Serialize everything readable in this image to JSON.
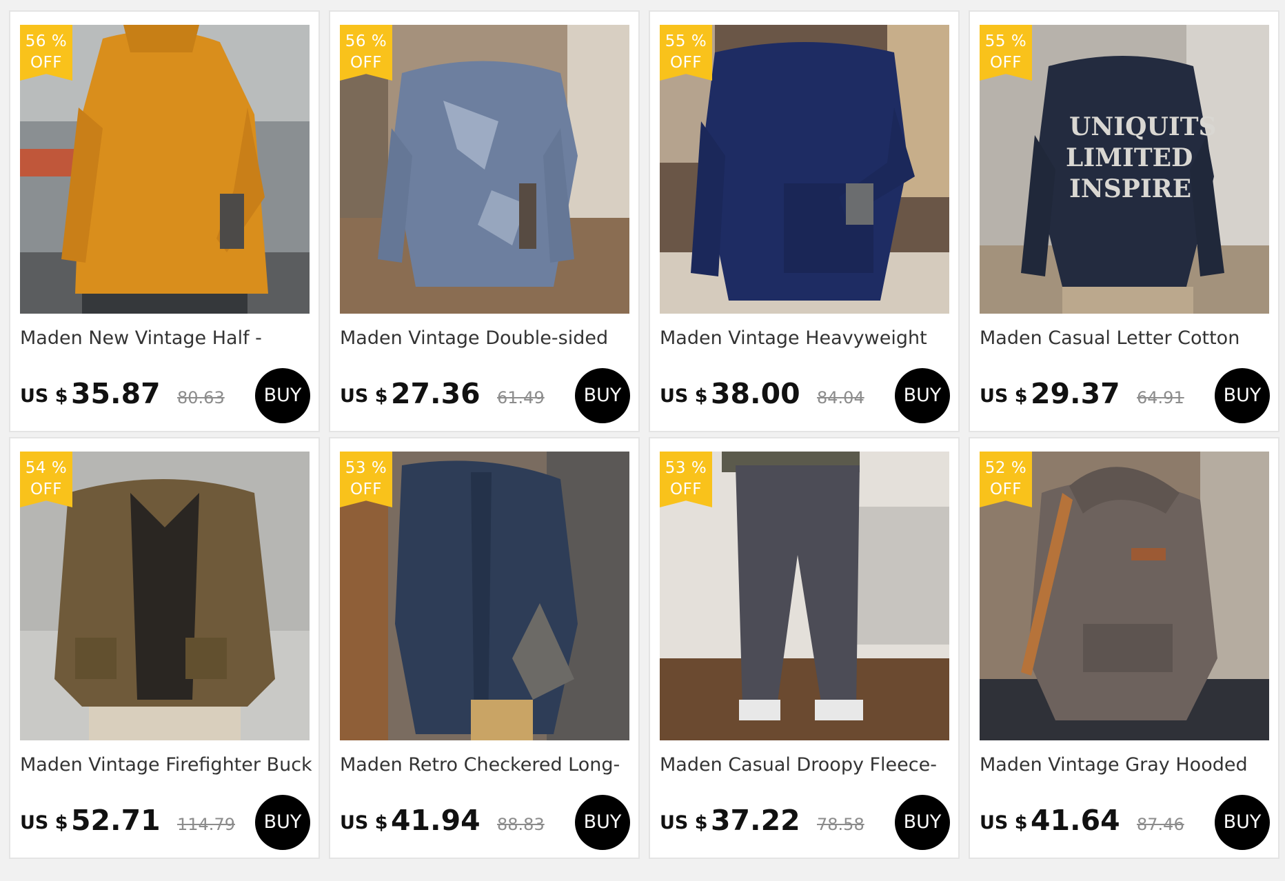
{
  "colors": {
    "badge": "#f9c21b",
    "buy_button": "#000000",
    "page_background": "#f1f1f1"
  },
  "products": [
    {
      "discount_pct": "56 %",
      "discount_off": "OFF",
      "title": "Maden New Vintage Half -",
      "currency": "US $",
      "price": "35.87",
      "old_price": "80.63",
      "buy_label": "BUY",
      "image": "man in mustard yellow knit sweater"
    },
    {
      "discount_pct": "56 %",
      "discount_off": "OFF",
      "title": "Maden Vintage Double-sided",
      "currency": "US $",
      "price": "27.36",
      "old_price": "61.49",
      "buy_label": "BUY",
      "image": "man in heather blue long sleeve tee"
    },
    {
      "discount_pct": "55 %",
      "discount_off": "OFF",
      "title": "Maden Vintage Heavyweight",
      "currency": "US $",
      "price": "38.00",
      "old_price": "84.04",
      "buy_label": "BUY",
      "image": "man in navy crewneck sweatshirt with pocket"
    },
    {
      "discount_pct": "55 %",
      "discount_off": "OFF",
      "title": "Maden Casual Letter Cotton",
      "currency": "US $",
      "price": "29.37",
      "old_price": "64.91",
      "buy_label": "BUY",
      "image": "man in navy letter print sweatshirt"
    },
    {
      "discount_pct": "54 %",
      "discount_off": "OFF",
      "title": "Maden Vintage Firefighter Buckle",
      "currency": "US $",
      "price": "52.71",
      "old_price": "114.79",
      "buy_label": "BUY",
      "image": "man in olive brown work jacket"
    },
    {
      "discount_pct": "53 %",
      "discount_off": "OFF",
      "title": "Maden Retro Checkered Long-",
      "currency": "US $",
      "price": "41.94",
      "old_price": "88.83",
      "buy_label": "BUY",
      "image": "man in navy checkered denim shirt"
    },
    {
      "discount_pct": "53 %",
      "discount_off": "OFF",
      "title": "Maden Casual Droopy Fleece-",
      "currency": "US $",
      "price": "37.22",
      "old_price": "78.58",
      "buy_label": "BUY",
      "image": "grey corduroy wide-leg trousers"
    },
    {
      "discount_pct": "52 %",
      "discount_off": "OFF",
      "title": "Maden Vintage Gray Hooded",
      "currency": "US $",
      "price": "41.64",
      "old_price": "87.46",
      "buy_label": "BUY",
      "image": "man in grey hooded sweatshirt"
    }
  ]
}
